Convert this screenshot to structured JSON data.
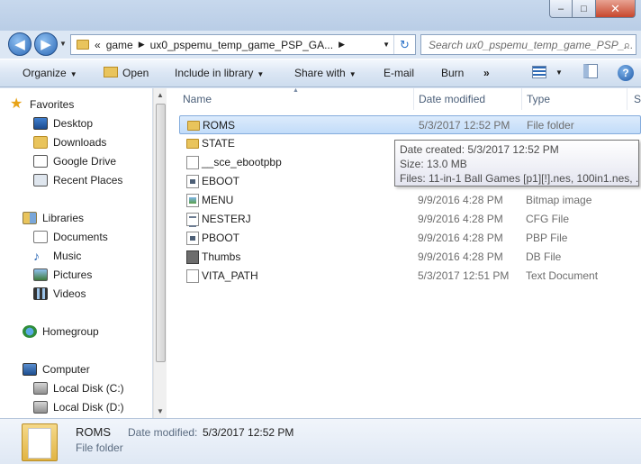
{
  "window": {
    "min_label": "–",
    "max_label": "□",
    "close_label": "✕"
  },
  "nav": {
    "back": "◀",
    "forward": "▶",
    "address_prefix": "«",
    "breadcrumbs": [
      "game",
      "ux0_pspemu_temp_game_PSP_GA..."
    ],
    "search_placeholder": "Search ux0_pspemu_temp_game_PSP_..."
  },
  "toolbar": {
    "organize": "Organize",
    "open": "Open",
    "include_in_library": "Include in library",
    "share_with": "Share with",
    "email": "E-mail",
    "burn": "Burn",
    "more": "»",
    "help": "?"
  },
  "navpane": {
    "favorites": "Favorites",
    "desktop": "Desktop",
    "downloads": "Downloads",
    "google_drive": "Google Drive",
    "recent_places": "Recent Places",
    "libraries": "Libraries",
    "documents": "Documents",
    "music": "Music",
    "pictures": "Pictures",
    "videos": "Videos",
    "homegroup": "Homegroup",
    "computer": "Computer",
    "local_c": "Local Disk (C:)",
    "local_d": "Local Disk (D:)"
  },
  "columns": {
    "name": "Name",
    "date": "Date modified",
    "type": "Type",
    "size": "S"
  },
  "files": [
    {
      "name": "ROMS",
      "date": "5/3/2017 12:52 PM",
      "type": "File folder",
      "icon": "folder-icon"
    },
    {
      "name": "STATE",
      "date": "",
      "type": "",
      "icon": "folder-icon"
    },
    {
      "name": "__sce_ebootpbp",
      "date": "",
      "type": "",
      "icon": "file-icon"
    },
    {
      "name": "EBOOT",
      "date": "",
      "type": "",
      "icon": "app-icon"
    },
    {
      "name": "MENU",
      "date": "9/9/2016 4:28 PM",
      "type": "Bitmap image",
      "icon": "bitmap-icon"
    },
    {
      "name": "NESTERJ",
      "date": "9/9/2016 4:28 PM",
      "type": "CFG File",
      "icon": "cfg-icon"
    },
    {
      "name": "PBOOT",
      "date": "9/9/2016 4:28 PM",
      "type": "PBP File",
      "icon": "pbp-icon"
    },
    {
      "name": "Thumbs",
      "date": "9/9/2016 4:28 PM",
      "type": "DB File",
      "icon": "db-icon"
    },
    {
      "name": "VITA_PATH",
      "date": "5/3/2017 12:51 PM",
      "type": "Text Document",
      "icon": "text-icon"
    }
  ],
  "tooltip": {
    "created": "Date created: 5/3/2017 12:52 PM",
    "size": "Size: 13.0 MB",
    "files": "Files: 11-in-1 Ball Games [p1][!].nes, 100in1.nes, ..."
  },
  "details": {
    "name": "ROMS",
    "modified_label": "Date modified:",
    "modified_value": "5/3/2017 12:52 PM",
    "type": "File folder"
  },
  "colors": {
    "selection": "#cce4fc",
    "accent": "#2b68b5"
  }
}
